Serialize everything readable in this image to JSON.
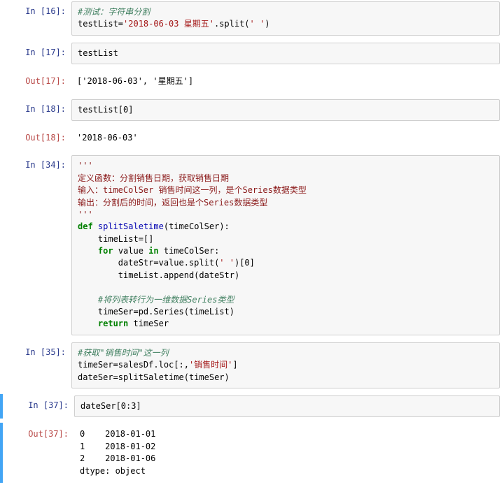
{
  "cells": [
    {
      "in_prompt": "In  [16]:",
      "code_html": "<span class='c-comment'>#测试：字符串分割</span>\ntestList=<span class='c-str'>'2018-06-03 星期五'</span>.split(<span class='c-str'>' '</span>)"
    },
    {
      "in_prompt": "In  [17]:",
      "code_html": "testList",
      "out_prompt": "Out[17]:",
      "out_text": "['2018-06-03', '星期五']"
    },
    {
      "in_prompt": "In  [18]:",
      "code_html": "testList[0]",
      "out_prompt": "Out[18]:",
      "out_text": "'2018-06-03'"
    },
    {
      "in_prompt": "In  [34]:",
      "code_html": "<span class='c-strdoc'>'''\n定义函数：分割销售日期，获取销售日期\n输入：timeColSer 销售时间这一列，是个Series数据类型\n输出：分割后的时间，返回也是个Series数据类型\n'''</span>\n<span class='c-kw'>def</span> <span class='c-def'>splitSaletime</span>(timeColSer):\n    timeList=[]\n    <span class='c-kw'>for</span> value <span class='c-kw'>in</span> timeColSer:\n        dateStr=value.split(<span class='c-str'>' '</span>)[0]\n        timeList.append(dateStr)\n\n    <span class='c-comment'>#将列表转行为一维数据Series类型</span>\n    timeSer=pd.Series(timeList)\n    <span class='c-kw'>return</span> timeSer"
    },
    {
      "in_prompt": "In  [35]:",
      "code_html": "<span class='c-comment'>#获取\"销售时间\"这一列</span>\ntimeSer=salesDf.loc[:,<span class='c-str'>'销售时间'</span>]\ndateSer=splitSaletime(timeSer)"
    },
    {
      "selected": true,
      "in_prompt": "In  [37]:",
      "code_html": "dateSer[0:3]",
      "out_prompt": "Out[37]:",
      "out_text": "0    2018-01-01\n1    2018-01-02\n2    2018-01-06\ndtype: object"
    }
  ]
}
